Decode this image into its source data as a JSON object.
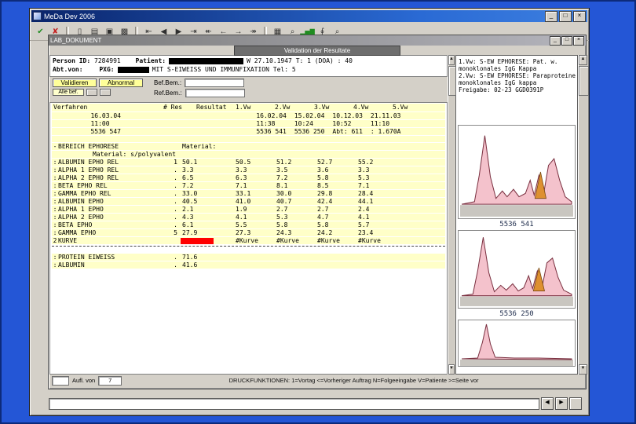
{
  "window": {
    "title": "MeDa Dev 2006",
    "minimize": "_",
    "maximize": "□",
    "close": "×"
  },
  "toolbar": {
    "icons": [
      {
        "glyph": "✔"
      },
      {
        "glyph": "✘"
      },
      {
        "glyph": "▯"
      },
      {
        "glyph": "▤"
      },
      {
        "glyph": "▣"
      },
      {
        "glyph": "▩"
      },
      {
        "glyph": "⇤"
      },
      {
        "glyph": "◀"
      },
      {
        "glyph": "▶"
      },
      {
        "glyph": "⇥"
      },
      {
        "glyph": "↞"
      },
      {
        "glyph": "←"
      },
      {
        "glyph": "→"
      },
      {
        "glyph": "↠"
      },
      {
        "glyph": "▦"
      },
      {
        "glyph": "⌕"
      },
      {
        "glyph": "▂▅▇"
      },
      {
        "glyph": "∮"
      },
      {
        "glyph": "⌕"
      }
    ]
  },
  "child": {
    "title": "LAB_DOKUMENT",
    "dialog_title": "Validation der Resultate",
    "patient": {
      "person_label": "Person ID:",
      "person_id": "7284991",
      "patient_label": "Patient:",
      "line1_right": "W 27.10.1947   T: 1  (DOA) : 40",
      "dept_label": "Abt.von:",
      "pxg_label": "PXG:",
      "line2_right": "MIT S-EIWEISS UND IMMUNFIXATION   Tel: 5"
    },
    "actions": {
      "validate": "Validieren",
      "abnormal": "Abnormal",
      "all_results": "Alle bef."
    },
    "fields": {
      "field1_label": "Bef.Bem.:",
      "field1_value": "",
      "field2_label": "Ref.Bem.:",
      "field2_value": ""
    },
    "table": {
      "headers": [
        "Verfahren",
        "# Res",
        "Resultat",
        "1.Vw",
        "2.Vw",
        "3.Vw",
        "4.Vw",
        "5.Vw"
      ],
      "meta": [
        {
          "left": "16.03.04",
          "vw": [
            "16.02.04",
            "15.02.04",
            "10.12.03",
            "21.11.03"
          ]
        },
        {
          "left": "11:00",
          "vw": [
            "11:38",
            "10:24",
            "10:52",
            "11:10"
          ]
        },
        {
          "left": "5536 547",
          "vw": [
            "5536 541",
            "5536 250",
            "Abt: 611",
            ": 1.670A"
          ]
        }
      ],
      "section": {
        "prefix": "-",
        "name": "BEREICH EPHORESE",
        "extra": "Material:",
        "line2": "Material: s/polyvalent"
      },
      "rows": [
        {
          "prefix": ":",
          "name": "ALBUMIN EPHO REL",
          "res": "1",
          "result": "50.1",
          "vw": [
            "50.5",
            "51.2",
            "52.7",
            "55.2"
          ]
        },
        {
          "prefix": ":",
          "name": "ALPHA 1 EPHO REL",
          "res": ".",
          "result": "3.3",
          "vw": [
            "3.3",
            "3.5",
            "3.6",
            "3.3"
          ]
        },
        {
          "prefix": ":",
          "name": "ALPHA 2 EPHO REL",
          "res": ".",
          "result": "6.5",
          "vw": [
            "6.3",
            "7.2",
            "5.8",
            "5.3"
          ]
        },
        {
          "prefix": ":",
          "name": "BETA EPHO REL",
          "res": ".",
          "result": "7.2",
          "vw": [
            "7.1",
            "8.1",
            "8.5",
            "7.1"
          ]
        },
        {
          "prefix": ":",
          "name": "GAMMA EPHO REL",
          "res": ".",
          "result": "33.0",
          "vw": [
            "33.1",
            "30.0",
            "29.8",
            "28.4"
          ]
        },
        {
          "prefix": ":",
          "name": "ALBUMIN EPHO",
          "res": ".",
          "result": "40.5",
          "vw": [
            "41.0",
            "40.7",
            "42.4",
            "44.1"
          ]
        },
        {
          "prefix": ":",
          "name": "ALPHA 1 EPHO",
          "res": ".",
          "result": "2.1",
          "vw": [
            "1.9",
            "2.7",
            "2.7",
            "2.4"
          ]
        },
        {
          "prefix": ":",
          "name": "ALPHA 2 EPHO",
          "res": ".",
          "result": "4.3",
          "vw": [
            "4.1",
            "5.3",
            "4.7",
            "4.1"
          ]
        },
        {
          "prefix": ":",
          "name": "BETA EPHO",
          "res": ".",
          "result": "6.1",
          "vw": [
            "5.5",
            "5.8",
            "5.8",
            "5.7"
          ]
        },
        {
          "prefix": ":",
          "name": "GAMMA EPHO",
          "res": "5",
          "result": "27.9",
          "vw": [
            "27.3",
            "24.3",
            "24.2",
            "23.4"
          ]
        },
        {
          "prefix": "2",
          "name": "KURVE",
          "res": "",
          "result": "",
          "vw": [
            "#Kurve",
            "#Kurve",
            "#Kurve",
            "#Kurve"
          ]
        }
      ],
      "rows2": [
        {
          "prefix": ":",
          "name": "PROTEIN EIWEISS",
          "res": ".",
          "result": "71.6",
          "vw": [
            "",
            "",
            "",
            ""
          ]
        },
        {
          "prefix": ":",
          "name": "ALBUMIN",
          "res": ".",
          "result": "41.6",
          "vw": [
            "",
            "",
            "",
            ""
          ]
        }
      ]
    },
    "report": {
      "lines": [
        "1.Vw: S-EW EPHORESE: Pat. w.",
        "monoklonales IgG Kappa",
        "2.Vw: S-EW EPHORESE: Paraproteine",
        "monoklonales IgG kappa",
        "",
        "Freigabe: 02-23 GGD0391P"
      ],
      "curve_labels": [
        "5536 541",
        "5536 250"
      ]
    },
    "bottom": {
      "box1": "",
      "label": "Aufl. von",
      "box2": "7",
      "status": "DRUCKFUNKTIONEN: 1=Vortag   <=Vorheriger Auftrag   N=Folgeeingabe   V=Patiente   >=Seite vor"
    }
  },
  "command": {
    "value": ""
  },
  "colors": {
    "titlebar_blue": "#0a246a",
    "row_yellow": "#ffffc8",
    "alert_red": "#ff0000",
    "button_yellow": "#ffff99",
    "desktop_blue": "#2456d6"
  }
}
